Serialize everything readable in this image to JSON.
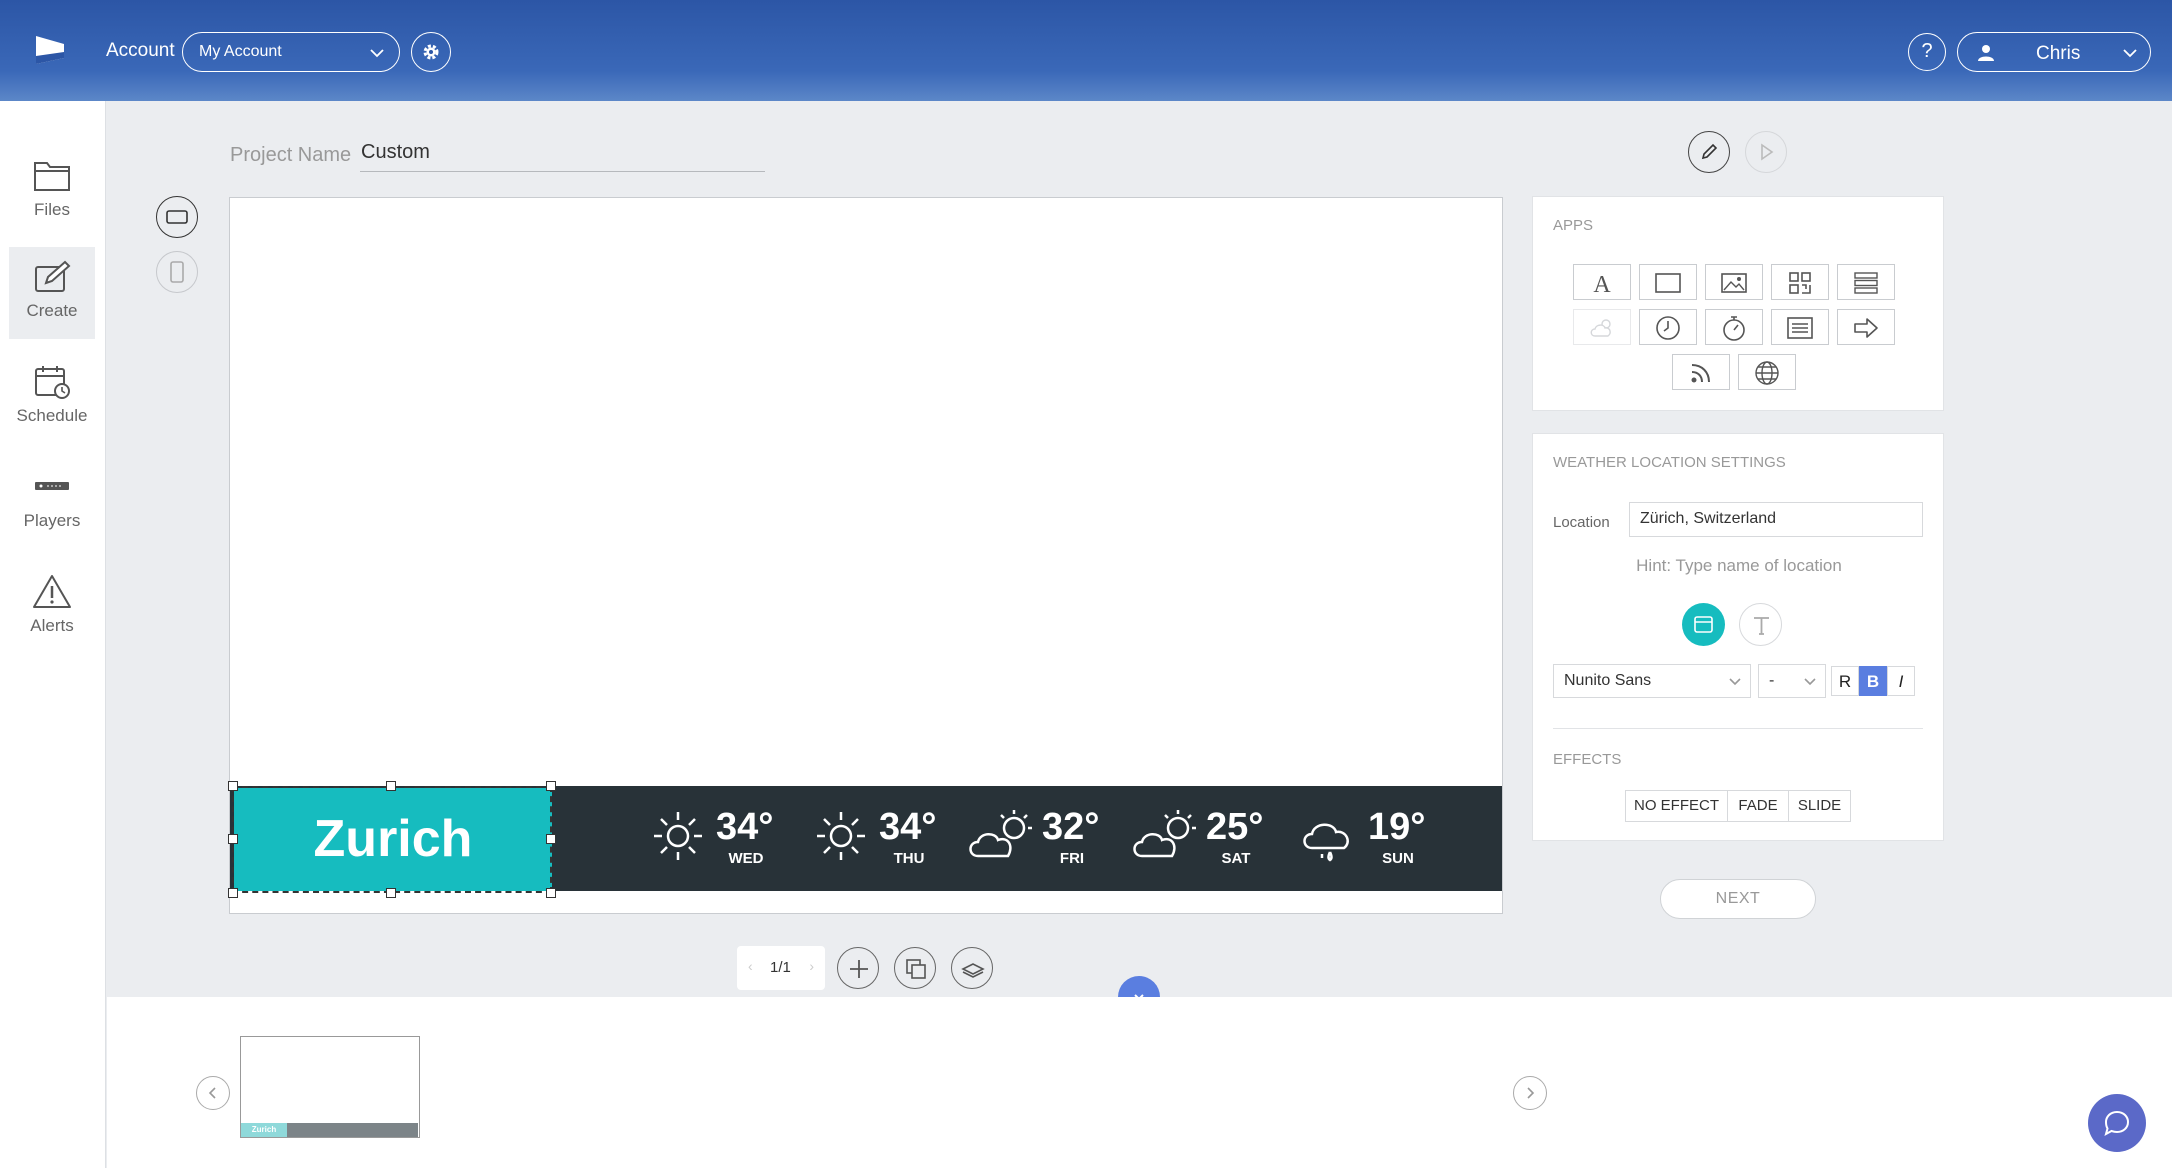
{
  "header": {
    "account_label": "Account",
    "account_value": "My Account",
    "help_label": "?",
    "user_name": "Chris"
  },
  "sidebar": {
    "items": [
      {
        "label": "Files",
        "icon": "folder-icon"
      },
      {
        "label": "Create",
        "icon": "edit-icon",
        "active": true
      },
      {
        "label": "Schedule",
        "icon": "calendar-icon"
      },
      {
        "label": "Players",
        "icon": "player-icon"
      },
      {
        "label": "Alerts",
        "icon": "alert-icon"
      }
    ]
  },
  "editor": {
    "project_label": "Project Name",
    "project_value": "Custom",
    "mode": "edit"
  },
  "canvas": {
    "city": "Zurich",
    "forecast": [
      {
        "temp": "34°",
        "day": "WED",
        "icon": "sun-icon"
      },
      {
        "temp": "34°",
        "day": "THU",
        "icon": "sun-icon"
      },
      {
        "temp": "32°",
        "day": "FRI",
        "icon": "partly-cloudy-icon"
      },
      {
        "temp": "25°",
        "day": "SAT",
        "icon": "partly-cloudy-icon"
      },
      {
        "temp": "19°",
        "day": "SUN",
        "icon": "rain-icon"
      }
    ]
  },
  "pager": {
    "page": "1/1",
    "prev": "‹",
    "next": "›"
  },
  "apps_panel": {
    "title": "APPS"
  },
  "weather_panel": {
    "title": "WEATHER LOCATION SETTINGS",
    "location_label": "Location",
    "location_value": "Zürich, Switzerland",
    "hint": "Hint: Type name of location",
    "font_value": "Nunito Sans",
    "size_value": "-",
    "regular_label": "R",
    "bold_label": "B",
    "italic_label": "I",
    "effects_title": "EFFECTS",
    "effects": [
      "NO EFFECT",
      "FADE",
      "SLIDE"
    ]
  },
  "next_label": "NEXT",
  "thumbnail": {
    "city": "Zurich"
  },
  "colors": {
    "header": "#2c56a6",
    "accent_teal": "#16bcbf",
    "accent_blue": "#5a7ee0",
    "weather_bar": "#283238",
    "chat": "#5b69c8"
  }
}
